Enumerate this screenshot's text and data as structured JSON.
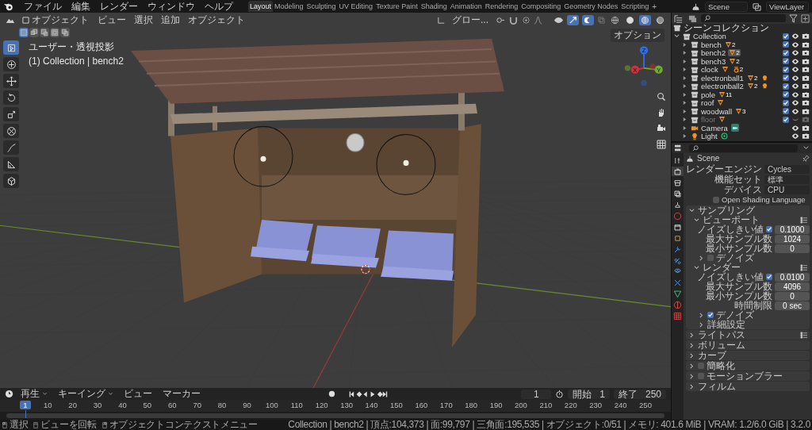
{
  "menu": [
    "ファイル",
    "編集",
    "レンダー",
    "ウィンドウ",
    "ヘルプ"
  ],
  "workspaces": [
    {
      "label": "Layout",
      "selected": true
    },
    {
      "label": "Modeling",
      "selected": false
    },
    {
      "label": "Sculpting",
      "selected": false
    },
    {
      "label": "UV Editing",
      "selected": false
    },
    {
      "label": "Texture Paint",
      "selected": false
    },
    {
      "label": "Shading",
      "selected": false
    },
    {
      "label": "Animation",
      "selected": false
    },
    {
      "label": "Rendering",
      "selected": false
    },
    {
      "label": "Compositing",
      "selected": false
    },
    {
      "label": "Geometry Nodes",
      "selected": false
    },
    {
      "label": "Scripting",
      "selected": false
    }
  ],
  "add_workspace": "+",
  "scene": "Scene",
  "view_layer": "ViewLayer",
  "viewport": {
    "mode": "オブジェクト",
    "menus": [
      "ビュー",
      "選択",
      "追加",
      "オブジェクト"
    ],
    "orientation": "グロー...",
    "options": "オプション",
    "view_name": "ユーザー・透視投影",
    "view_object": "(1) Collection | bench2",
    "select_modes": [
      {
        "kind": "set",
        "selected": true
      },
      {
        "kind": "extend",
        "selected": false
      },
      {
        "kind": "subtract",
        "selected": false
      },
      {
        "kind": "invert",
        "selected": false
      },
      {
        "kind": "intersect",
        "selected": false
      }
    ],
    "shading_modes": [
      {
        "kind": "wireframe",
        "selected": false
      },
      {
        "kind": "solid",
        "selected": false
      },
      {
        "kind": "material",
        "selected": true
      },
      {
        "kind": "rendered",
        "selected": false
      }
    ],
    "tools": [
      {
        "kind": "select",
        "selected": true
      },
      {
        "kind": "cursor",
        "selected": false
      },
      {
        "kind": "move",
        "selected": false
      },
      {
        "kind": "rotate",
        "selected": false
      },
      {
        "kind": "scale",
        "selected": false
      },
      {
        "kind": "transform",
        "selected": false
      },
      {
        "kind": "annotate",
        "selected": false
      },
      {
        "kind": "measure",
        "selected": false
      },
      {
        "kind": "cube",
        "selected": false
      }
    ],
    "gizmo": {
      "x": "X",
      "y": "Y",
      "z": "Z"
    }
  },
  "outliner": {
    "root": "シーンコレクション",
    "collection": {
      "name": "Collection",
      "expanded": true,
      "checked": true,
      "visible": true,
      "children": [
        {
          "name": "bench",
          "kind": "object",
          "selected": false,
          "checked": true,
          "visible": true,
          "data": [
            {
              "kind": "mesh",
              "count": "2"
            }
          ]
        },
        {
          "name": "bench2",
          "kind": "object",
          "selected": true,
          "checked": true,
          "visible": true,
          "data": [
            {
              "kind": "mesh",
              "count": "2"
            }
          ]
        },
        {
          "name": "bench3",
          "kind": "object",
          "selected": false,
          "checked": true,
          "visible": true,
          "data": [
            {
              "kind": "mesh",
              "count": "2"
            }
          ]
        },
        {
          "name": "clock",
          "kind": "object",
          "selected": false,
          "checked": true,
          "visible": true,
          "data": [
            {
              "kind": "mesh"
            },
            {
              "kind": "text",
              "count": "2"
            }
          ]
        },
        {
          "name": "electronball1",
          "kind": "object",
          "selected": false,
          "checked": true,
          "visible": true,
          "data": [
            {
              "kind": "mesh",
              "count": "2"
            },
            {
              "kind": "lamp"
            }
          ]
        },
        {
          "name": "electronball2",
          "kind": "object",
          "selected": false,
          "checked": true,
          "visible": true,
          "data": [
            {
              "kind": "mesh",
              "count": "2"
            },
            {
              "kind": "lamp"
            }
          ]
        },
        {
          "name": "pole",
          "kind": "object",
          "selected": false,
          "checked": true,
          "visible": true,
          "data": [
            {
              "kind": "mesh",
              "count": "11"
            }
          ]
        },
        {
          "name": "roof",
          "kind": "object",
          "selected": false,
          "checked": true,
          "visible": true,
          "data": [
            {
              "kind": "mesh"
            }
          ]
        },
        {
          "name": "woodwall",
          "kind": "object",
          "selected": false,
          "checked": true,
          "visible": true,
          "data": [
            {
              "kind": "mesh",
              "count": "3"
            }
          ]
        },
        {
          "name": "floor",
          "kind": "object",
          "selected": false,
          "checked": true,
          "visible": false,
          "data": [
            {
              "kind": "mesh"
            }
          ]
        },
        {
          "name": "Camera",
          "kind": "camera",
          "selected": false,
          "visible": true,
          "data": [
            {
              "kind": "camera-data"
            }
          ]
        },
        {
          "name": "Light",
          "kind": "light",
          "selected": false,
          "visible": true,
          "data": [
            {
              "kind": "light-data"
            }
          ]
        }
      ]
    }
  },
  "properties": {
    "tabs": [
      {
        "kind": "tool",
        "selected": false
      },
      {
        "kind": "render",
        "selected": true
      },
      {
        "kind": "output",
        "selected": false
      },
      {
        "kind": "view-layer",
        "selected": false
      },
      {
        "kind": "scene",
        "selected": false
      },
      {
        "kind": "world",
        "selected": false
      },
      {
        "kind": "collection",
        "selected": false
      },
      {
        "kind": "object",
        "selected": false
      },
      {
        "kind": "modifier",
        "selected": false
      },
      {
        "kind": "particles",
        "selected": false
      },
      {
        "kind": "physics",
        "selected": false
      },
      {
        "kind": "constraints",
        "selected": false
      },
      {
        "kind": "data",
        "selected": false
      },
      {
        "kind": "material",
        "selected": false
      },
      {
        "kind": "texture",
        "selected": false
      }
    ],
    "context": "Scene",
    "fields": [
      {
        "label": "レンダーエンジン",
        "value": "Cycles"
      },
      {
        "label": "機能セット",
        "value": "標準"
      },
      {
        "label": "デバイス",
        "value": "CPU"
      }
    ],
    "osl": {
      "label": "Open Shading Language",
      "checked": false
    },
    "panels": [
      {
        "title": "サンプリング",
        "expanded": true,
        "children": [
          {
            "title": "ビューポート",
            "expanded": true,
            "presets": true,
            "rows": [
              {
                "label": "ノイズしきい値",
                "checked": true,
                "value": "0.1000"
              },
              {
                "label": "最大サンプル数",
                "value": "1024"
              },
              {
                "label": "最小サンプル数",
                "value": "0"
              }
            ],
            "children": [
              {
                "title": "デノイズ",
                "expanded": false,
                "checked": false
              }
            ]
          },
          {
            "title": "レンダー",
            "expanded": true,
            "presets": true,
            "rows": [
              {
                "label": "ノイズしきい値",
                "checked": true,
                "value": "0.0100"
              },
              {
                "label": "最大サンプル数",
                "value": "4096"
              },
              {
                "label": "最小サンプル数",
                "value": "0"
              },
              {
                "label": "時間制限",
                "value": "0 sec"
              }
            ],
            "children": [
              {
                "title": "デノイズ",
                "expanded": false,
                "checked": true
              },
              {
                "title": "詳細設定",
                "expanded": false
              }
            ]
          }
        ]
      },
      {
        "title": "ライトパス",
        "expanded": false,
        "presets": true
      },
      {
        "title": "ボリューム",
        "expanded": false
      },
      {
        "title": "カーブ",
        "expanded": false
      },
      {
        "title": "簡略化",
        "expanded": false,
        "checked": false
      },
      {
        "title": "モーションブラー",
        "expanded": false,
        "checked": false
      },
      {
        "title": "フィルム",
        "expanded": false
      }
    ]
  },
  "timeline": {
    "menus": [
      {
        "label": "再生",
        "dropdown": true
      },
      {
        "label": "キーイング",
        "dropdown": true
      },
      {
        "label": "ビュー",
        "dropdown": false
      },
      {
        "label": "マーカー",
        "dropdown": false
      }
    ],
    "current_frame": "1",
    "start_label": "開始",
    "start": "1",
    "end_label": "終了",
    "end": "250",
    "ticks": [
      "1",
      "10",
      "20",
      "30",
      "40",
      "50",
      "60",
      "70",
      "80",
      "90",
      "100",
      "110",
      "120",
      "130",
      "140",
      "150",
      "160",
      "170",
      "180",
      "190",
      "200",
      "210",
      "220",
      "230",
      "240",
      "250"
    ]
  },
  "status_bar": {
    "hints": [
      {
        "kind": "mouse-left",
        "label": "選択"
      },
      {
        "kind": "mouse-middle",
        "label": "ビューを回転"
      },
      {
        "kind": "mouse-right",
        "label": "オブジェクトコンテクストメニュー"
      }
    ],
    "stats": "Collection | bench2 | 頂点:104,373 | 面:99,797 | 三角面:195,535 | オブジェクト:0/51 | メモリ: 401.6 MiB | VRAM: 1.2/6.0 GiB | 3.2.0"
  }
}
